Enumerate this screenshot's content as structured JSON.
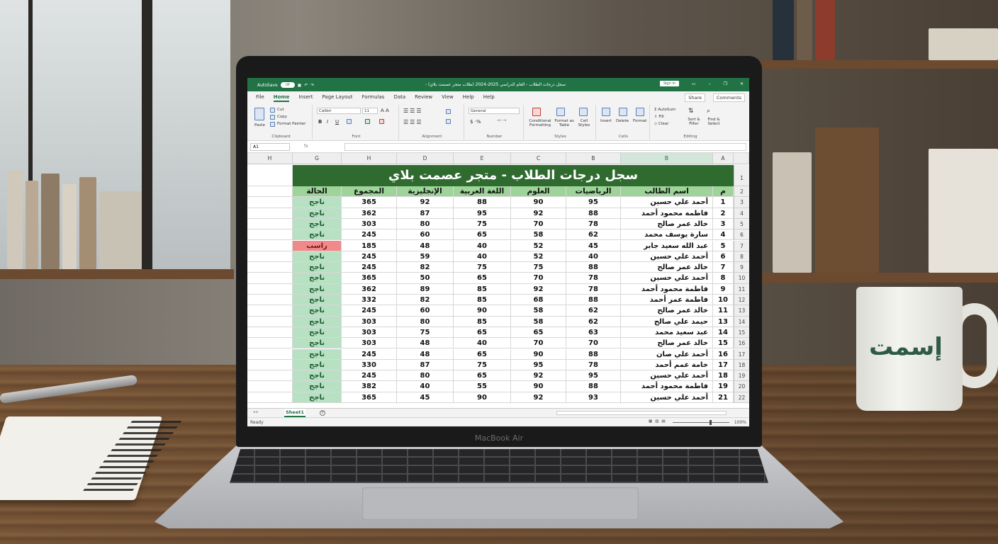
{
  "window": {
    "autosave": "AutoSave",
    "autosave_toggle": "Off",
    "title": "سجل درجات الطلاب - العام الدراسي 2025-2024 (طلاب متجر عصمت بلاي) -",
    "sign_in": "Sign in"
  },
  "menu": {
    "tabs": [
      "File",
      "Home",
      "Insert",
      "Page Layout",
      "Formulas",
      "Data",
      "Review",
      "View",
      "Help",
      "Help"
    ],
    "share": "Share",
    "comments": "Comments"
  },
  "ribbon": {
    "clipboard": {
      "label": "Clipboard",
      "paste": "Paste",
      "cut": "Cut",
      "copy": "Copy",
      "format_painter": "Format Painter"
    },
    "font": {
      "label": "Font",
      "family": "Calibri",
      "size": "11"
    },
    "alignment": {
      "label": "Alignment"
    },
    "number": {
      "label": "Number",
      "format": "General"
    },
    "styles": {
      "label": "Styles",
      "conditional": "Conditional Formatting",
      "format_table": "Format as Table",
      "cell_styles": "Cell Styles"
    },
    "cells": {
      "label": "Cells",
      "insert": "Insert",
      "delete": "Delete",
      "format": "Format"
    },
    "editing": {
      "label": "Editing",
      "autosum": "AutoSum",
      "fill": "Fill",
      "clear": "Clear",
      "sort": "Sort & Filter",
      "find": "Find & Select"
    }
  },
  "formula_bar": {
    "name_box": "A1",
    "fx": "fx",
    "value": ""
  },
  "sheet": {
    "col_headers": [
      "H",
      "G",
      "H",
      "D",
      "E",
      "C",
      "B",
      "B",
      "A"
    ],
    "title": "سجل درجات الطلاب - متجر عصمت بلاي",
    "headers": [
      "الحالة",
      "المجموع",
      "الإنجليزية",
      "اللغة العربية",
      "العلوم",
      "الرياضيات",
      "اسم الطالب",
      "م"
    ],
    "row_numbers": [
      "1",
      "2",
      "3",
      "4",
      "5",
      "6",
      "7",
      "8",
      "9",
      "10",
      "11",
      "12",
      "13",
      "14",
      "15",
      "16",
      "17",
      "18",
      "19",
      "20",
      "22"
    ],
    "rows": [
      {
        "n": "1",
        "name": "أحمد علي حسين",
        "math": "95",
        "sci": "90",
        "ar": "88",
        "en": "92",
        "total": "365",
        "status": "ناجح",
        "pass": true
      },
      {
        "n": "2",
        "name": "فاطمة محمود أحمد",
        "math": "88",
        "sci": "92",
        "ar": "95",
        "en": "87",
        "total": "362",
        "status": "ناجح",
        "pass": true
      },
      {
        "n": "3",
        "name": "خالد عمر صالح",
        "math": "78",
        "sci": "70",
        "ar": "75",
        "en": "80",
        "total": "303",
        "status": "ناجح",
        "pass": true
      },
      {
        "n": "4",
        "name": "سارة يوسف محمد",
        "math": "62",
        "sci": "58",
        "ar": "65",
        "en": "60",
        "total": "245",
        "status": "ناجح",
        "pass": true
      },
      {
        "n": "5",
        "name": "عبد الله سعيد جابر",
        "math": "45",
        "sci": "52",
        "ar": "40",
        "en": "48",
        "total": "185",
        "status": "راسب",
        "pass": false
      },
      {
        "n": "6",
        "name": "أحمد علي حسين",
        "math": "40",
        "sci": "52",
        "ar": "40",
        "en": "59",
        "total": "245",
        "status": "ناجح",
        "pass": true
      },
      {
        "n": "7",
        "name": "خالد عمر صالح",
        "math": "88",
        "sci": "75",
        "ar": "75",
        "en": "82",
        "total": "245",
        "status": "ناجح",
        "pass": true
      },
      {
        "n": "8",
        "name": "أحمد علي حسين",
        "math": "78",
        "sci": "70",
        "ar": "65",
        "en": "50",
        "total": "365",
        "status": "ناجح",
        "pass": true
      },
      {
        "n": "9",
        "name": "فاطمة محمود أحمد",
        "math": "78",
        "sci": "92",
        "ar": "85",
        "en": "89",
        "total": "362",
        "status": "ناجح",
        "pass": true
      },
      {
        "n": "10",
        "name": "فاطمة عمر أحمد",
        "math": "88",
        "sci": "68",
        "ar": "85",
        "en": "82",
        "total": "332",
        "status": "ناجح",
        "pass": true
      },
      {
        "n": "11",
        "name": "خالد عمر صالح",
        "math": "62",
        "sci": "58",
        "ar": "90",
        "en": "60",
        "total": "245",
        "status": "ناجح",
        "pass": true
      },
      {
        "n": "13",
        "name": "حيمد علي صالح",
        "math": "62",
        "sci": "58",
        "ar": "85",
        "en": "80",
        "total": "303",
        "status": "ناجح",
        "pass": true
      },
      {
        "n": "14",
        "name": "عبد سعيد محمد",
        "math": "63",
        "sci": "65",
        "ar": "65",
        "en": "75",
        "total": "303",
        "status": "ناجح",
        "pass": true
      },
      {
        "n": "15",
        "name": "خالد عمر صالح",
        "math": "70",
        "sci": "70",
        "ar": "40",
        "en": "48",
        "total": "303",
        "status": "ناجح",
        "pass": true
      },
      {
        "n": "16",
        "name": "أحمد علي صان",
        "math": "88",
        "sci": "90",
        "ar": "65",
        "en": "48",
        "total": "245",
        "status": "ناجح",
        "pass": true
      },
      {
        "n": "17",
        "name": "خامة عمم أحمد",
        "math": "78",
        "sci": "95",
        "ar": "75",
        "en": "87",
        "total": "330",
        "status": "ناجح",
        "pass": true
      },
      {
        "n": "18",
        "name": "أحمد علي حسين",
        "math": "95",
        "sci": "92",
        "ar": "65",
        "en": "80",
        "total": "245",
        "status": "ناجح",
        "pass": true
      },
      {
        "n": "19",
        "name": "فاطمة محمود أحمد",
        "math": "88",
        "sci": "90",
        "ar": "55",
        "en": "40",
        "total": "382",
        "status": "ناجح",
        "pass": true
      },
      {
        "n": "21",
        "name": "أحمد علي حسين",
        "math": "93",
        "sci": "92",
        "ar": "90",
        "en": "45",
        "total": "365",
        "status": "ناجح",
        "pass": true
      }
    ],
    "tab_name": "Sheet1"
  },
  "status": {
    "ready": "Ready",
    "zoom": "100%"
  },
  "laptop": {
    "brand": "MacBook Air"
  },
  "mug": {
    "text": "إسمت"
  },
  "colors": {
    "excel_green": "#217346",
    "title_green": "#2f6a2e",
    "header_green": "#9ed399",
    "pass": "#b7e1c2",
    "fail": "#f08989"
  }
}
